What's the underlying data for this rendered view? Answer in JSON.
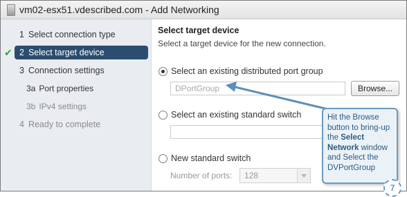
{
  "window": {
    "title": "vm02-esx51.vdescribed.com - Add Networking"
  },
  "sidebar": {
    "steps": [
      {
        "num": "1",
        "label": "Select connection type"
      },
      {
        "num": "2",
        "label": "Select target device"
      },
      {
        "num": "3",
        "label": "Connection settings"
      },
      {
        "num": "3a",
        "label": "Port properties"
      },
      {
        "num": "3b",
        "label": "IPv4 settings"
      },
      {
        "num": "4",
        "label": "Ready to complete"
      }
    ]
  },
  "main": {
    "title": "Select target device",
    "subtitle": "Select a target device for the new connection.",
    "options": {
      "distributed": {
        "label": "Select an existing distributed port group",
        "value": "DPortGroup",
        "browse_label": "Browse..."
      },
      "standard": {
        "label": "Select an existing standard switch"
      },
      "new_switch": {
        "label": "New standard switch",
        "ports_label": "Number of ports:",
        "ports_value": "128"
      }
    }
  },
  "annotation": {
    "line1": "Hit the Browse button to bring-up the ",
    "bold1": "Select Network",
    "line2": " window and Select the DVPortGroup",
    "step_number": "7",
    "color": "#6a9bc1"
  }
}
